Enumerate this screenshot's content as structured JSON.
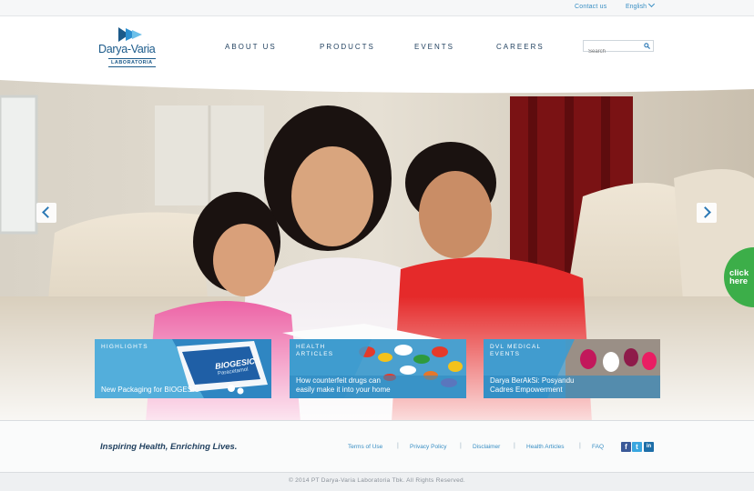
{
  "topbar": {
    "contact_label": "Contact us",
    "language_label": "English"
  },
  "header": {
    "logo_name": "Darya-Varia",
    "logo_sub": "LABORATORIA",
    "nav": [
      {
        "label": "ABOUT US"
      },
      {
        "label": "PRODUCTS"
      },
      {
        "label": "EVENTS"
      },
      {
        "label": "CAREERS"
      }
    ],
    "search_placeholder": "Search"
  },
  "hero": {
    "prev_icon": "chevron-left-icon",
    "next_icon": "chevron-right-icon",
    "click_here_line1": "click",
    "click_here_line2": "here",
    "click_here_color": "#3cae49"
  },
  "tiles": [
    {
      "category": "HIGHLIGHTS",
      "caption": "New Packaging for BIOGESIC",
      "product_name": "BIOGESIC",
      "product_sub": "Paracetamol"
    },
    {
      "category_line1": "HEALTH",
      "category_line2": "ARTICLES",
      "caption_line1": "How counterfeit drugs can",
      "caption_line2": "easily make it into your home"
    },
    {
      "category_line1": "DVL MEDICAL",
      "category_line2": "EVENTS",
      "caption_line1": "Darya BerAkSi: Posyandu",
      "caption_line2": "Cadres Empowerment"
    }
  ],
  "footer": {
    "tagline": "Inspiring Health, Enriching Lives.",
    "links": [
      "Terms of Use",
      "Privacy Policy",
      "Disclaimer",
      "Health Articles",
      "FAQ"
    ],
    "separator": "|",
    "social": [
      {
        "icon": "facebook-icon",
        "glyph": "f",
        "color": "#3b5998"
      },
      {
        "icon": "twitter-icon",
        "glyph": "t",
        "color": "#3aa7e0"
      },
      {
        "icon": "linkedin-icon",
        "glyph": "in",
        "color": "#1d6ea8"
      }
    ],
    "copyright": "© 2014 PT Darya-Varia Laboratoria Tbk. All Rights Reserved."
  },
  "colors": {
    "brand_blue": "#1b5a8a",
    "link_blue": "#3a8fc4",
    "tile_blue": "#4aa8d8"
  }
}
